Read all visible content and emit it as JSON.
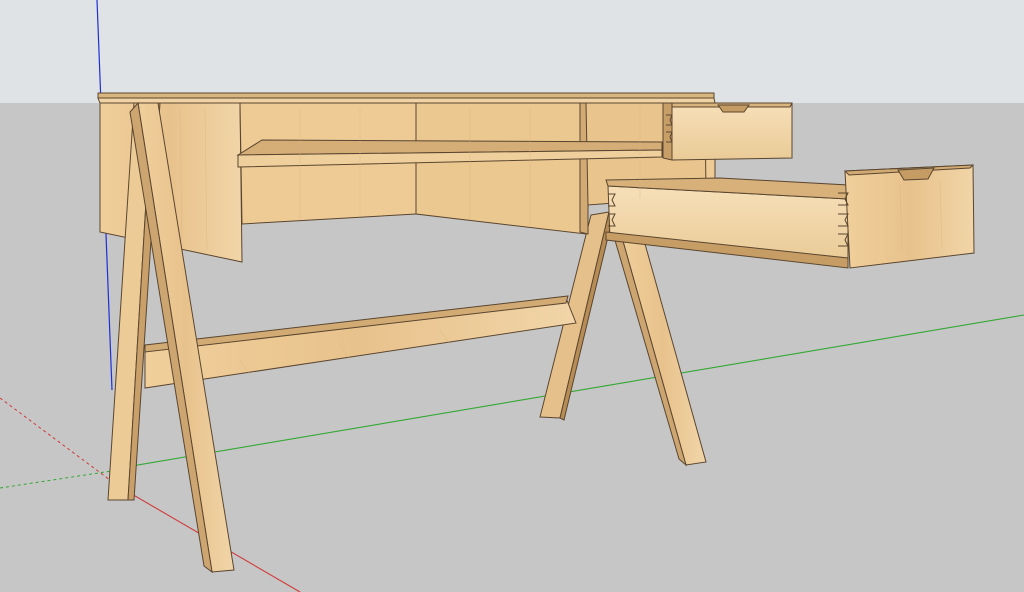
{
  "app": {
    "window_title": ""
  },
  "viewport": {
    "sky_color": "#dfe3e6",
    "ground_color": "#c6c6c6",
    "axes": {
      "blue_axis_color": "#1f2fd6",
      "green_axis_color": "#33a833",
      "red_axis_color": "#d13a3a"
    }
  },
  "model": {
    "name": "",
    "components": [
      "desk-top",
      "left-side-panel",
      "back-panel",
      "center-divider",
      "right-divider",
      "pullout-writing-shelf",
      "upper-drawer",
      "lower-drawer",
      "left-front-leg",
      "left-back-leg",
      "right-front-leg",
      "right-back-leg",
      "stretcher-rail"
    ],
    "wood_colors": {
      "light": "#f1d3a2",
      "mid": "#e7c089",
      "dark": "#caa069",
      "shadow": "#a57c45",
      "edge": "#5a4630"
    }
  }
}
